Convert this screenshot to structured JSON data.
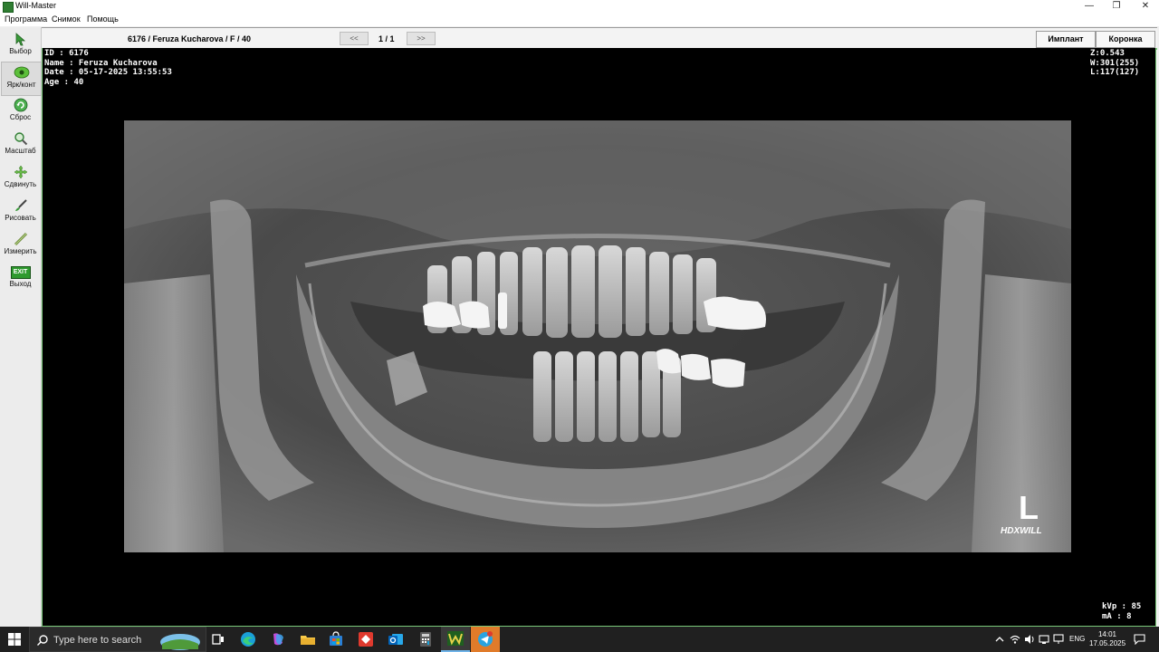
{
  "window": {
    "title": "Will-Master",
    "minimize": "—",
    "restore": "❐",
    "close": "✕"
  },
  "menu": [
    "Программа",
    "Снимок",
    "Помощь"
  ],
  "tools": [
    {
      "label": "Выбор",
      "icon": "cursor-icon"
    },
    {
      "label": "Ярк/конт",
      "icon": "contrast-icon"
    },
    {
      "label": "Сброс",
      "icon": "reset-icon"
    },
    {
      "label": "Масштаб",
      "icon": "zoom-icon"
    },
    {
      "label": "Сдвинуть",
      "icon": "pan-icon"
    },
    {
      "label": "Рисовать",
      "icon": "brush-icon"
    },
    {
      "label": "Измерить",
      "icon": "ruler-icon"
    },
    {
      "label": "Выход",
      "icon": "exit-icon",
      "badge": "EXIT"
    }
  ],
  "header": {
    "patient_title": "6176 / Feruza Kucharova / F / 40",
    "prev": "<<",
    "next": ">>",
    "page_indicator": "1 / 1",
    "implant_button": "Имплант",
    "crown_button": "Коронка"
  },
  "overlay": {
    "id": "ID : 6176",
    "name": "Name : Feruza Kucharova",
    "date": "Date : 05-17-2025 13:55:53",
    "age": "Age : 40",
    "zoom": "Z:0.543",
    "window": "W:301(255)",
    "level": "L:117(127)",
    "kvp": "kVp : 85",
    "ma": "mA : 8",
    "side_marker": "L",
    "brand": "HDXWILL"
  },
  "taskbar": {
    "search_placeholder": "Type here to search",
    "lang": "ENG",
    "time": "14:01",
    "date": "17.05.2025"
  },
  "colors": {
    "accent_green": "#79c879",
    "viewer_bg": "#000000",
    "taskbar_bg": "#202020"
  }
}
